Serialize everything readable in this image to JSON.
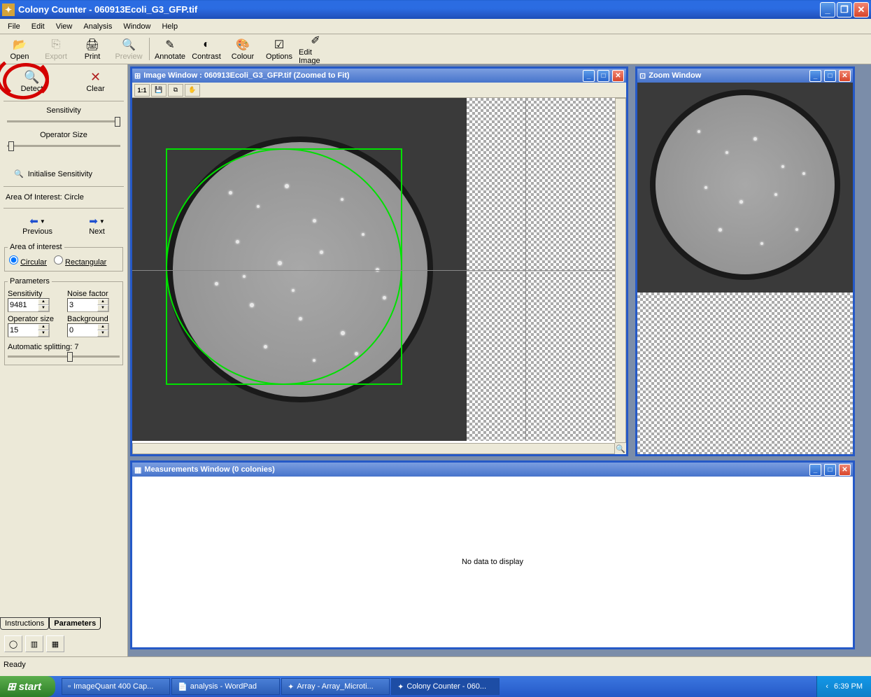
{
  "titlebar": {
    "title": "Colony Counter - 060913Ecoli_G3_GFP.tif"
  },
  "menu": {
    "file": "File",
    "edit": "Edit",
    "view": "View",
    "analysis": "Analysis",
    "window": "Window",
    "help": "Help"
  },
  "toolbar": {
    "open": "Open",
    "export": "Export",
    "print": "Print",
    "preview": "Preview",
    "annotate": "Annotate",
    "contrast": "Contrast",
    "colour": "Colour",
    "options": "Options",
    "edit_image": "Edit Image"
  },
  "sidebar": {
    "detect": "Detect",
    "clear": "Clear",
    "sensitivity": "Sensitivity",
    "operator_size": "Operator Size",
    "init_sens": "Initialise Sensitivity",
    "aoi": "Area Of Interest:  Circle",
    "previous": "Previous",
    "next": "Next",
    "aoi_fieldset": "Area of interest",
    "circular": "Circular",
    "rectangular": "Rectangular",
    "parameters": "Parameters",
    "sensitivity_param": "Sensitivity",
    "noise_factor": "Noise factor",
    "operator_size_param": "Operator size",
    "background": "Background",
    "auto_split": "Automatic splitting:  7",
    "sensitivity_val": "9481",
    "noise_val": "3",
    "opsize_val": "15",
    "bg_val": "0",
    "tab_instructions": "Instructions",
    "tab_parameters": "Parameters"
  },
  "image_window": {
    "title": "Image Window : 060913Ecoli_G3_GFP.tif (Zoomed to Fit)",
    "tool_11": "1:1"
  },
  "zoom_window": {
    "title": "Zoom Window"
  },
  "measurements": {
    "title": "Measurements Window (0 colonies)",
    "empty": "No data to display"
  },
  "statusbar": {
    "text": "Ready"
  },
  "taskbar": {
    "start": "start",
    "items": [
      "ImageQuant 400 Cap...",
      "analysis - WordPad",
      "Array - Array_Microti...",
      "Colony Counter - 060..."
    ],
    "time": "6:39 PM"
  }
}
